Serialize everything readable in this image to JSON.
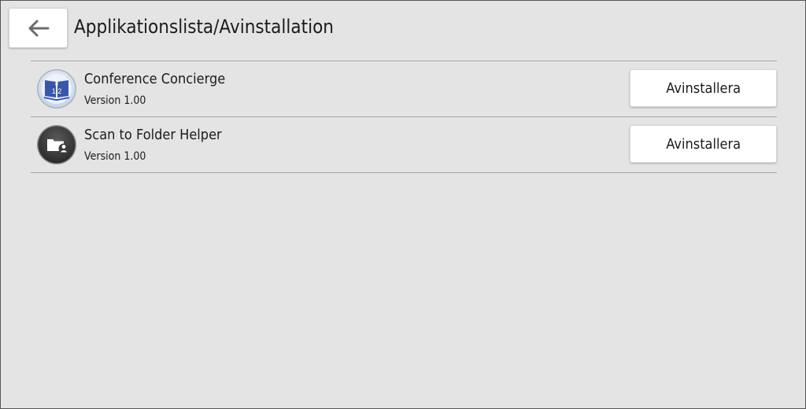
{
  "header": {
    "title": "Applikationslista/Avinstallation",
    "back_icon": "arrow-left-icon"
  },
  "apps": [
    {
      "name": "Conference Concierge",
      "version": "Version 1.00",
      "icon": "conference-book-icon",
      "icon_text": "1 2",
      "button_label": "Avinstallera"
    },
    {
      "name": "Scan to Folder Helper",
      "version": "Version 1.00",
      "icon": "folder-user-icon",
      "button_label": "Avinstallera"
    }
  ],
  "colors": {
    "background": "#e4e4e4",
    "button": "#ffffff",
    "divider": "#a6a6a6",
    "text": "#1b1b1b"
  }
}
